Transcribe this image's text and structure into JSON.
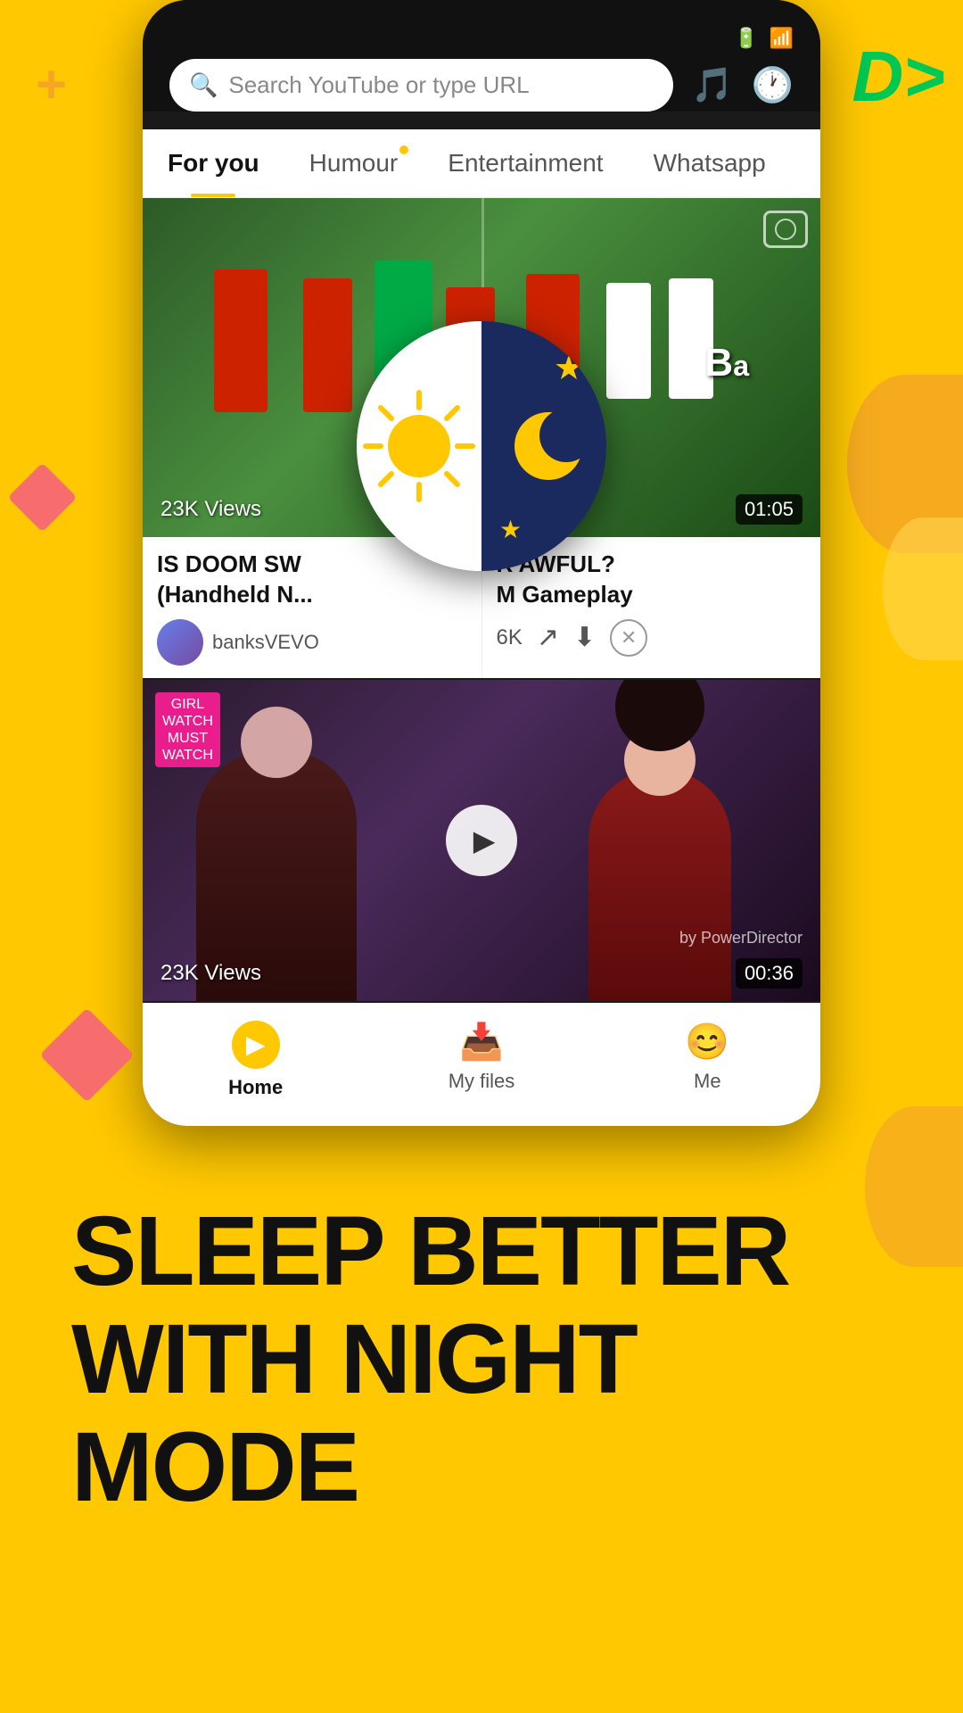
{
  "background_color": "#FFC800",
  "decorations": {
    "plus_symbol": "+",
    "arrow_symbol": "D>",
    "diamond_color": "#F76C6C",
    "orange_color": "#F5A623"
  },
  "phone": {
    "search": {
      "placeholder": "Search YouTube or type URL",
      "icon": "search"
    },
    "header_icons": {
      "music": "♪",
      "history": "↺"
    },
    "tabs": [
      {
        "label": "For you",
        "active": true,
        "dot": false
      },
      {
        "label": "Humour",
        "active": false,
        "dot": true
      },
      {
        "label": "Entertainment",
        "active": false,
        "dot": false
      },
      {
        "label": "Whatsapp",
        "active": false,
        "dot": false
      }
    ],
    "video_1": {
      "views": "23K Views",
      "duration": "01:05",
      "title_left": "IS DOOM SW",
      "title_right": "R AWFUL?",
      "subtitle_left": "(Handheld N...",
      "subtitle_right": "M Gameplay",
      "channel": "banksVEVO",
      "likes": "6K",
      "play_icon": "▶"
    },
    "video_2": {
      "views": "23K Views",
      "duration": "00:36",
      "powerdirector": "by PowerDirector",
      "play_icon": "▶"
    },
    "daynight": {
      "label": "Day Night Mode Icon"
    },
    "bottom_nav": [
      {
        "label": "Home",
        "icon": "home",
        "active": true
      },
      {
        "label": "My files",
        "icon": "files",
        "active": false
      },
      {
        "label": "Me",
        "icon": "me",
        "active": false
      }
    ]
  },
  "bottom_text": {
    "line1": "SLEEP BETTER",
    "line2": "WITH NIGHT MODE"
  }
}
